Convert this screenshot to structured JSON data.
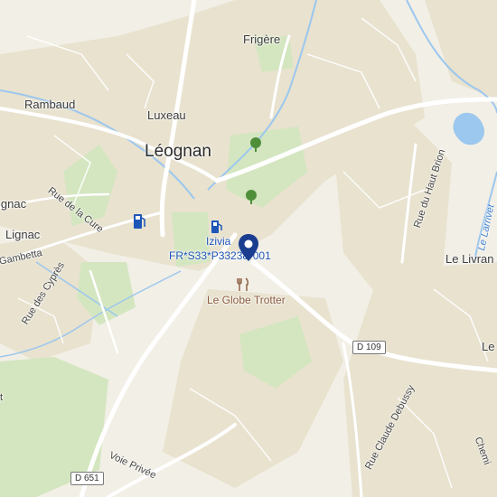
{
  "map": {
    "places": {
      "frigere": "Frigère",
      "rambaud": "Rambaud",
      "luxeau": "Luxeau",
      "leognan": "Léognan",
      "lignac_top": "ignac",
      "lignac": "Lignac",
      "le_livran": "Le Livran",
      "le_edge": "Le"
    },
    "streets": {
      "rue_de_la_cure": "Rue de la Cure",
      "gambetta": "Gambetta",
      "rue_des_cypres": "Rue des Cyprès",
      "rue_du_haut_brion": "Rue du Haut Brion",
      "rue_claude_debussy": "Rue Claude Debussy",
      "voie_privee": "Voie Privée",
      "chemin_edge": "Chemi",
      "t_edge": "t"
    },
    "water": {
      "larrivet": "Le Larrivet"
    },
    "road_shields": {
      "d109": "D 109",
      "d651": "D 651"
    },
    "pois": {
      "izivia_name": "Izivia",
      "izivia_id": "FR*S33*P33238*001",
      "restaurant": "Le Globe Trotter"
    },
    "icons": [
      "fuel-station-icon",
      "charging-station-icon",
      "location-pin-icon",
      "restaurant-icon",
      "park-tree-icon"
    ],
    "colors": {
      "background": "#f2efe6",
      "urban": "#e8e2cf",
      "green": "#d4e6c0",
      "water": "#9cc7ee",
      "road": "#ffffff",
      "pin": "#1a3d8f"
    }
  }
}
